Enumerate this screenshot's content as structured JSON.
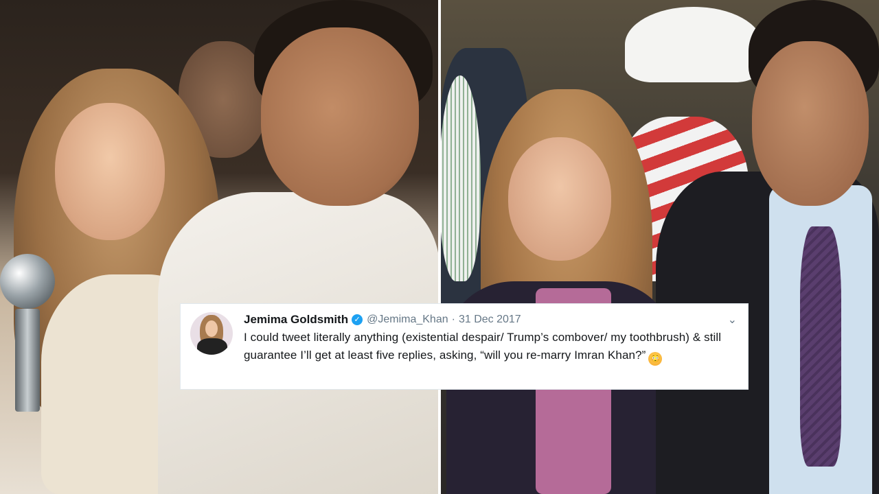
{
  "tweet": {
    "name": "Jemima Goldsmith",
    "handle": "@Jemima_Khan",
    "separator": "·",
    "date": "31 Dec 2017",
    "text": "I could tweet literally anything (existential despair/ Trump’s combover/ my toothbrush) & still guarantee I’ll get at least five replies, asking, “will you re-marry Imran Khan?”",
    "emoji": "😳",
    "verified_glyph": "✓",
    "menu_glyph": "⌄"
  },
  "icons": {
    "verified": "verified-badge-icon",
    "menu": "chevron-down-icon",
    "emoji": "flushed-face-emoji"
  },
  "colors": {
    "verified_blue": "#1da1f2",
    "name_text": "#14171a",
    "meta_text": "#657786",
    "card_bg": "#ffffff"
  }
}
